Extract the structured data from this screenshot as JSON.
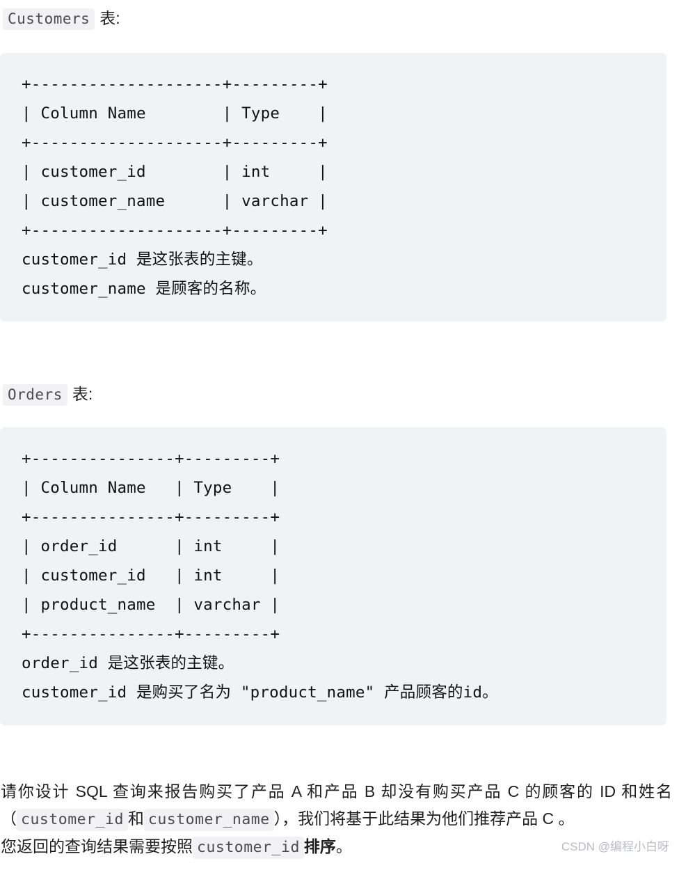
{
  "document": {
    "sections": [
      {
        "heading": {
          "code": "Customers",
          "suffix": "表:"
        },
        "code_block": "+--------------------+---------+\n| Column Name        | Type    |\n+--------------------+---------+\n| customer_id        | int     |\n| customer_name      | varchar |\n+--------------------+---------+\ncustomer_id 是这张表的主键。\ncustomer_name 是顾客的名称。"
      },
      {
        "heading": {
          "code": "Orders",
          "suffix": "表:"
        },
        "code_block": "+---------------+---------+\n| Column Name   | Type    |\n+---------------+---------+\n| order_id      | int     |\n| customer_id   | int     |\n| product_name  | varchar |\n+---------------+---------+\norder_id 是这张表的主键。\ncustomer_id 是购买了名为 \"product_name\" 产品顾客的id。"
      }
    ],
    "question": {
      "line1_a": "请你设计 SQL 查询来报告购买了产品 A 和产品 B 却没有购买产品 C 的顾客的 ID 和姓名（",
      "code1": "customer_id",
      "line1_b": "和",
      "code2": "customer_name",
      "line1_c": "），我们将基于此结果为他们推荐产品 C 。",
      "line2_a": "您返回的查询结果需要按照",
      "code3": "customer_id",
      "line2_b": "排序",
      "line2_c": "。"
    },
    "watermark": "CSDN @编程小白呀"
  },
  "colors": {
    "code_block_bg": "#f1f2f4",
    "chip_bg": "#f2f2f4",
    "text": "#1f1f1f",
    "chip_text": "#4b4b52",
    "watermark": "#b9bcc2"
  }
}
